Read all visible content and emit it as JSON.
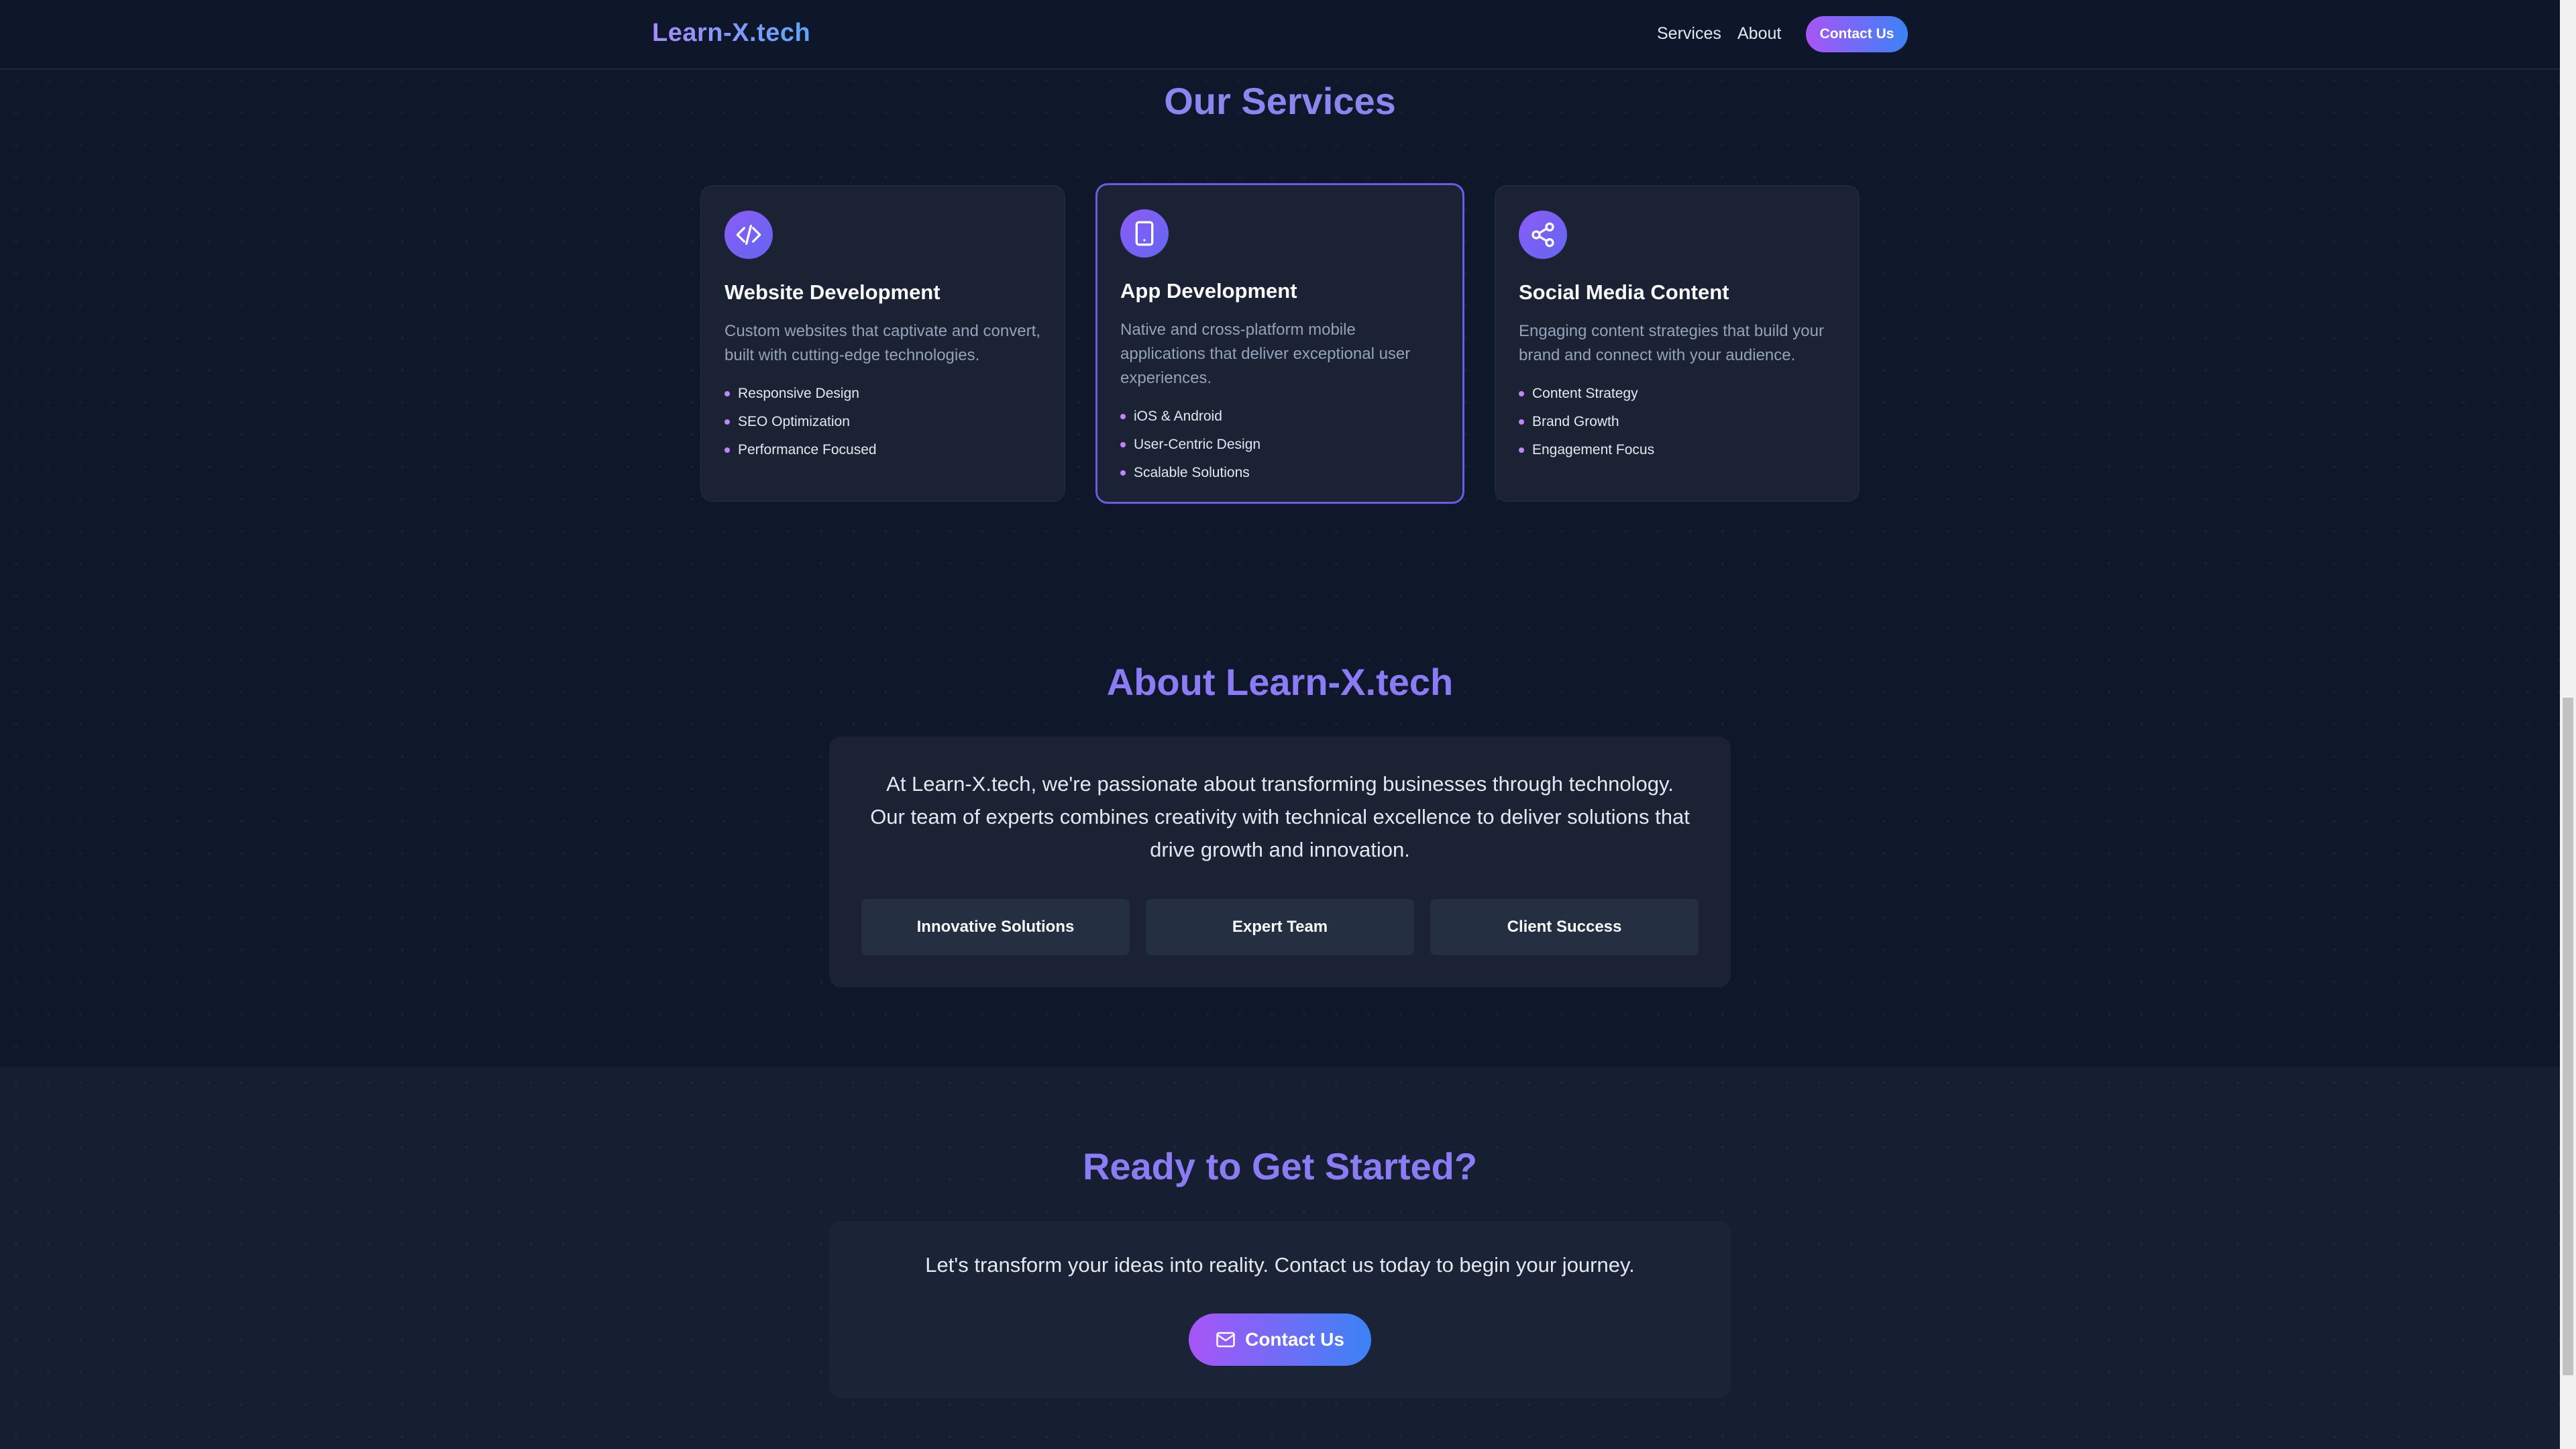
{
  "nav": {
    "brand": "Learn-X.tech",
    "links": [
      "Services",
      "About"
    ],
    "cta_label": "Contact Us"
  },
  "services": {
    "title": "Our Services",
    "cards": [
      {
        "icon": "code-icon",
        "title": "Website Development",
        "description": "Custom websites that captivate and convert, built with cutting-edge technologies.",
        "features": [
          "Responsive Design",
          "SEO Optimization",
          "Performance Focused"
        ]
      },
      {
        "icon": "smartphone-icon",
        "title": "App Development",
        "description": "Native and cross-platform mobile applications that deliver exceptional user experiences.",
        "features": [
          "iOS & Android",
          "User-Centric Design",
          "Scalable Solutions"
        ]
      },
      {
        "icon": "share-icon",
        "title": "Social Media Content",
        "description": "Engaging content strategies that build your brand and connect with your audience.",
        "features": [
          "Content Strategy",
          "Brand Growth",
          "Engagement Focus"
        ]
      }
    ]
  },
  "about": {
    "title": "About Learn-X.tech",
    "text": "At Learn-X.tech, we're passionate about transforming businesses through technology. Our team of experts combines creativity with technical excellence to deliver solutions that drive growth and innovation.",
    "pills": [
      "Innovative Solutions",
      "Expert Team",
      "Client Success"
    ]
  },
  "cta": {
    "title": "Ready to Get Started?",
    "text": "Let's transform your ideas into reality. Contact us today to begin your journey.",
    "button_label": "Contact Us",
    "button_icon": "mail-icon"
  },
  "colors": {
    "background": "#0f172a",
    "card": "#1a2234",
    "accent_purple": "#a855f7",
    "accent_blue": "#3b82f6",
    "heading": "#8b7cf6"
  }
}
